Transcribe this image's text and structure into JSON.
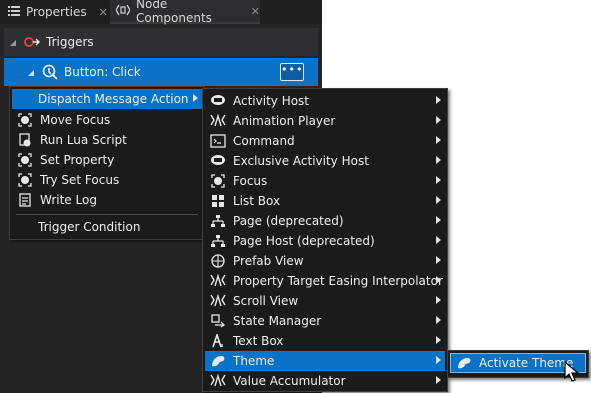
{
  "tabs": [
    {
      "label": "Properties",
      "icon": "list-icon",
      "close": "✕"
    },
    {
      "label": "Node Components",
      "icon": "components-icon",
      "close": "✕"
    }
  ],
  "section": {
    "title": "Triggers"
  },
  "trigger": {
    "label": "Button: Click",
    "more": "•••"
  },
  "main_menu": {
    "dispatch": "Dispatch Message Action",
    "items": [
      "Move Focus",
      "Run Lua Script",
      "Set Property",
      "Try Set Focus",
      "Write Log"
    ],
    "condition": "Trigger Condition"
  },
  "sub_menu": {
    "items": [
      "Activity Host",
      "Animation Player",
      "Command",
      "Exclusive Activity Host",
      "Focus",
      "List Box",
      "Page (deprecated)",
      "Page Host (deprecated)",
      "Prefab View",
      "Property Target Easing Interpolator",
      "Scroll View",
      "State Manager",
      "Text Box",
      "Theme",
      "Value Accumulator"
    ]
  },
  "theme_menu": {
    "item": "Activate Theme"
  },
  "colors": {
    "highlight": "#0a73c8",
    "menu_bg": "#1b1b1c",
    "panel_bg": "#252526"
  }
}
